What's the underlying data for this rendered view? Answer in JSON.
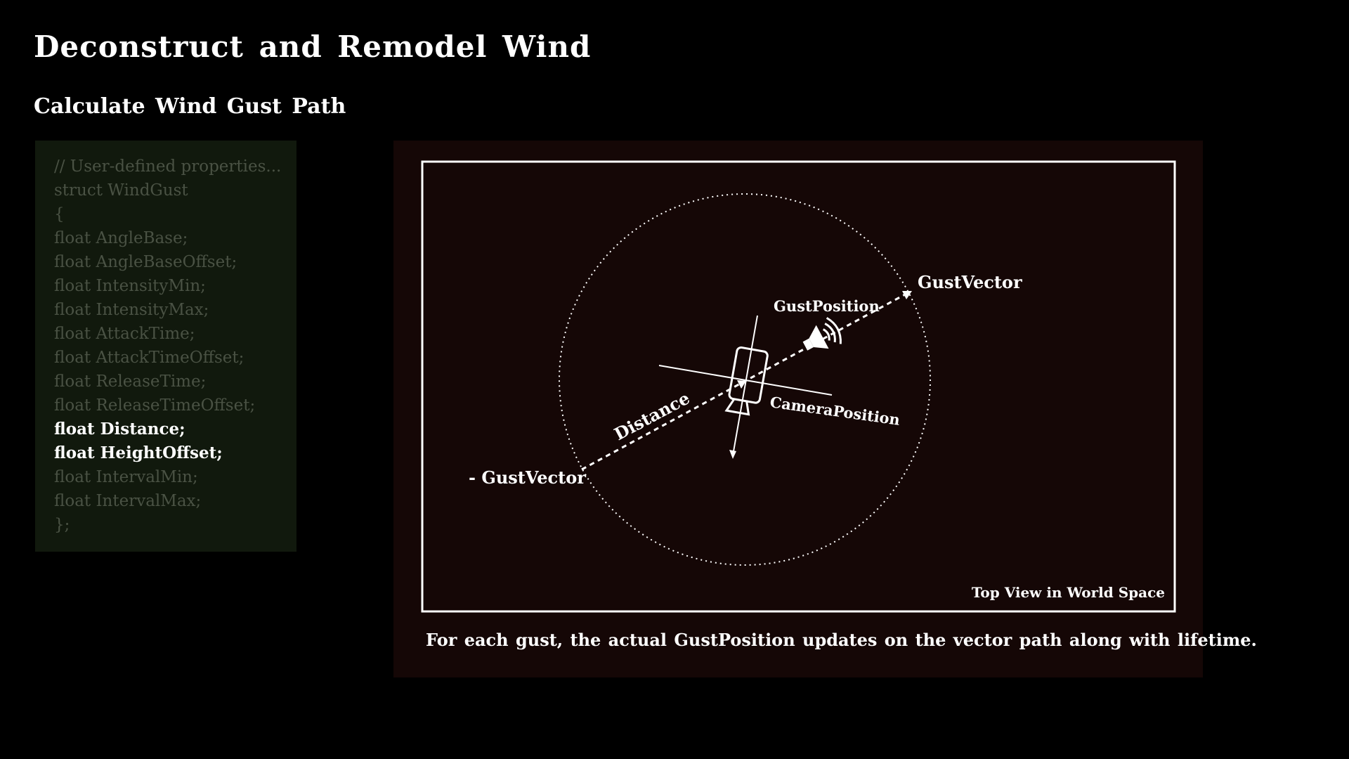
{
  "title": "Deconstruct and Remodel Wind",
  "subtitle": "Calculate Wind Gust Path",
  "code": {
    "lines": [
      {
        "text": "// User-defined properties...",
        "highlight": false
      },
      {
        "text": "struct WindGust",
        "highlight": false
      },
      {
        "text": "{",
        "highlight": false
      },
      {
        "text": "float AngleBase;",
        "highlight": false
      },
      {
        "text": "float AngleBaseOffset;",
        "highlight": false
      },
      {
        "text": "float IntensityMin;",
        "highlight": false
      },
      {
        "text": "float IntensityMax;",
        "highlight": false
      },
      {
        "text": "float AttackTime;",
        "highlight": false
      },
      {
        "text": "float AttackTimeOffset;",
        "highlight": false
      },
      {
        "text": "float ReleaseTime;",
        "highlight": false
      },
      {
        "text": "float ReleaseTimeOffset;",
        "highlight": false
      },
      {
        "text": "float Distance;",
        "highlight": true
      },
      {
        "text": "float HeightOffset;",
        "highlight": true
      },
      {
        "text": "float IntervalMin;",
        "highlight": false
      },
      {
        "text": "float IntervalMax;",
        "highlight": false
      },
      {
        "text": "};",
        "highlight": false
      }
    ]
  },
  "diagram": {
    "labels": {
      "gust_vector": "GustVector",
      "neg_gust_vector": "- GustVector",
      "gust_position": "GustPosition",
      "camera_position": "CameraPosition",
      "distance": "Distance",
      "view_label": "Top View in World Space"
    },
    "caption": "For each gust, the actual GustPosition updates on the vector path along with lifetime.",
    "colors": {
      "panel_bg": "#150706",
      "code_bg": "#11190d",
      "code_dim_text": "#4a5244",
      "line": "#ffffff"
    }
  }
}
